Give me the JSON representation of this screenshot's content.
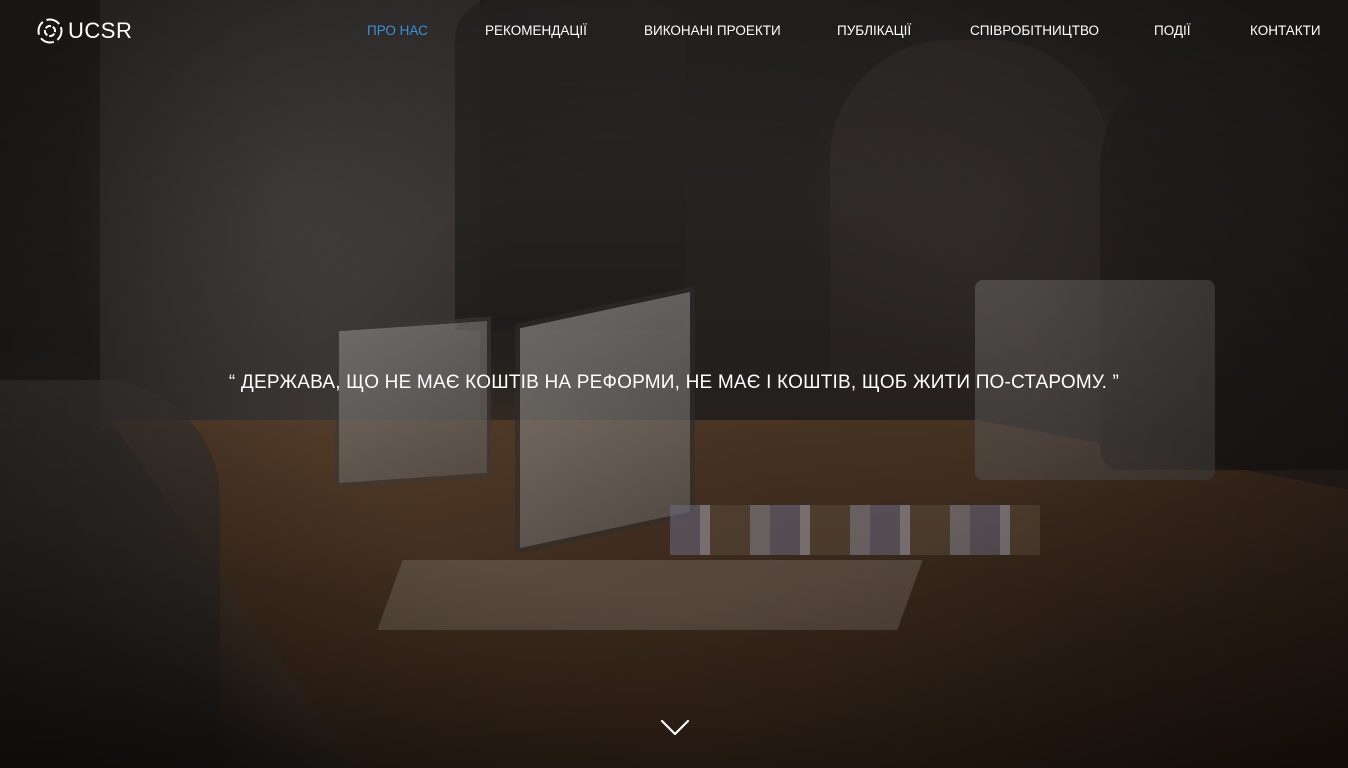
{
  "header": {
    "logo_text": "UCSR",
    "nav": [
      {
        "label": "ПРО НАС",
        "active": true
      },
      {
        "label": "РЕКОМЕНДАЦІЇ",
        "active": false
      },
      {
        "label": "ВИКОНАНІ ПРОЕКТИ",
        "active": false
      },
      {
        "label": "ПУБЛІКАЦІЇ",
        "active": false
      },
      {
        "label": "СПІВРОБІТНИЦТВО",
        "active": false
      },
      {
        "label": "ПОДІЇ",
        "active": false
      },
      {
        "label": "КОНТАКТИ",
        "active": false
      }
    ]
  },
  "hero": {
    "quote": "“ ДЕРЖАВА, ЩО НЕ МАЄ КОШТІВ НА РЕФОРМИ, НЕ МАЄ І КОШТІВ, ЩОБ ЖИТИ ПО-СТАРОМУ. ”",
    "scroll_icon": "chevron-down-icon"
  },
  "colors": {
    "accent": "#3d8fd6",
    "text": "#ffffff"
  }
}
